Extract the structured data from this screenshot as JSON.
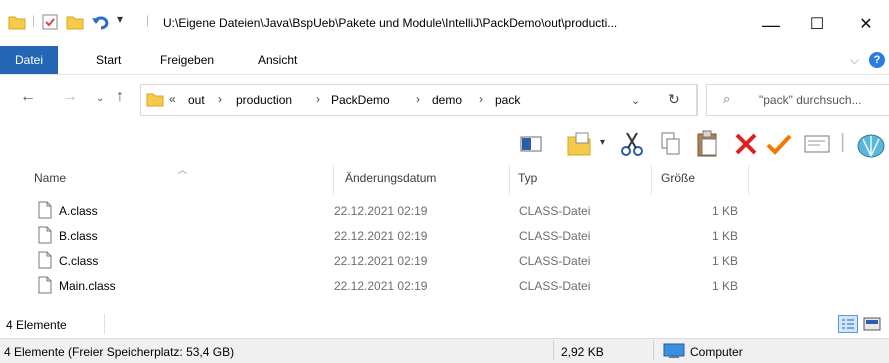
{
  "window": {
    "title": "U:\\Eigene Dateien\\Java\\BspUeb\\Pakete und Module\\IntelliJ\\PackDemo\\out\\producti...",
    "minimize": "—",
    "maximize": "☐",
    "close": "✕"
  },
  "ribbon": {
    "tabs": [
      "Datei",
      "Start",
      "Freigeben",
      "Ansicht"
    ],
    "help": "?"
  },
  "address": {
    "overflow": "«",
    "crumbs": [
      "out",
      "production",
      "PackDemo",
      "demo",
      "pack"
    ],
    "search_placeholder": "\"pack\" durchsuch..."
  },
  "columns": {
    "name": "Name",
    "date": "Änderungsdatum",
    "type": "Typ",
    "size": "Größe"
  },
  "files": [
    {
      "name": "A.class",
      "date": "22.12.2021 02:19",
      "type": "CLASS-Datei",
      "size": "1 KB"
    },
    {
      "name": "B.class",
      "date": "22.12.2021 02:19",
      "type": "CLASS-Datei",
      "size": "1 KB"
    },
    {
      "name": "C.class",
      "date": "22.12.2021 02:19",
      "type": "CLASS-Datei",
      "size": "1 KB"
    },
    {
      "name": "Main.class",
      "date": "22.12.2021 02:19",
      "type": "CLASS-Datei",
      "size": "1 KB"
    }
  ],
  "status": {
    "item_count": "4 Elemente",
    "free_space": "4 Elemente (Freier Speicherplatz: 53,4 GB)",
    "total_size": "2,92 KB",
    "location": "Computer"
  },
  "colors": {
    "accent": "#2266b4",
    "folder": "#f5c94a",
    "delete": "#e02020",
    "check": "#f07a00"
  }
}
